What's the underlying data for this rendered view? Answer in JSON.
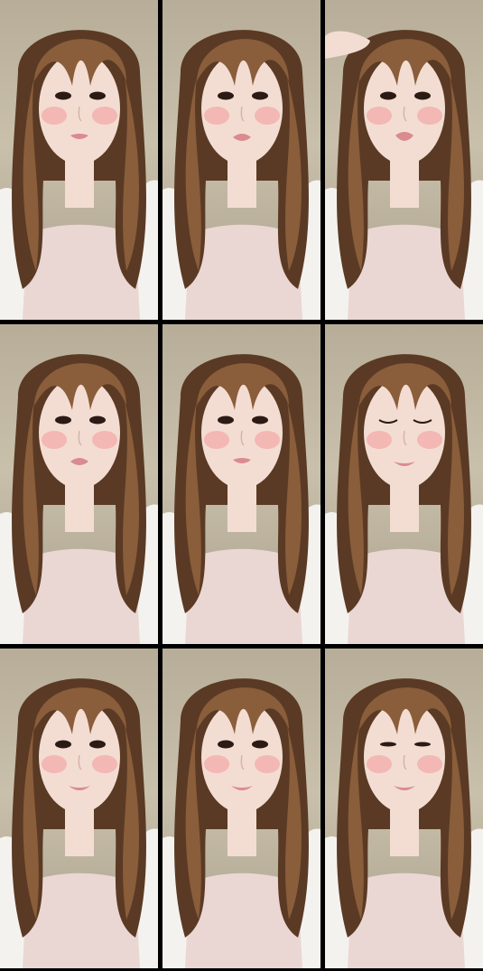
{
  "collage": {
    "rows": 3,
    "cols": 3,
    "frames": [
      {
        "id": 1,
        "eyes": "open",
        "mouth": "parted",
        "hand": false
      },
      {
        "id": 2,
        "eyes": "open",
        "mouth": "pout",
        "hand": false
      },
      {
        "id": 3,
        "eyes": "open",
        "mouth": "open",
        "hand": true
      },
      {
        "id": 4,
        "eyes": "open",
        "mouth": "pout",
        "hand": false
      },
      {
        "id": 5,
        "eyes": "open",
        "mouth": "parted",
        "hand": false
      },
      {
        "id": 6,
        "eyes": "closed",
        "mouth": "smile",
        "hand": false
      },
      {
        "id": 7,
        "eyes": "open",
        "mouth": "smile",
        "hand": false
      },
      {
        "id": 8,
        "eyes": "open",
        "mouth": "smile",
        "hand": false
      },
      {
        "id": 9,
        "eyes": "half",
        "mouth": "smile",
        "hand": false
      }
    ]
  },
  "colors": {
    "background_wall": "#c2b8a3",
    "hair": "#8a5d3b",
    "hair_dark": "#5a3a24",
    "skin": "#f3ddd3",
    "blush": "#f2a7a6",
    "top": "#ead7d3",
    "shirt": "#f4f2ef",
    "lips": "#d98b8f",
    "separator": "#000000"
  }
}
